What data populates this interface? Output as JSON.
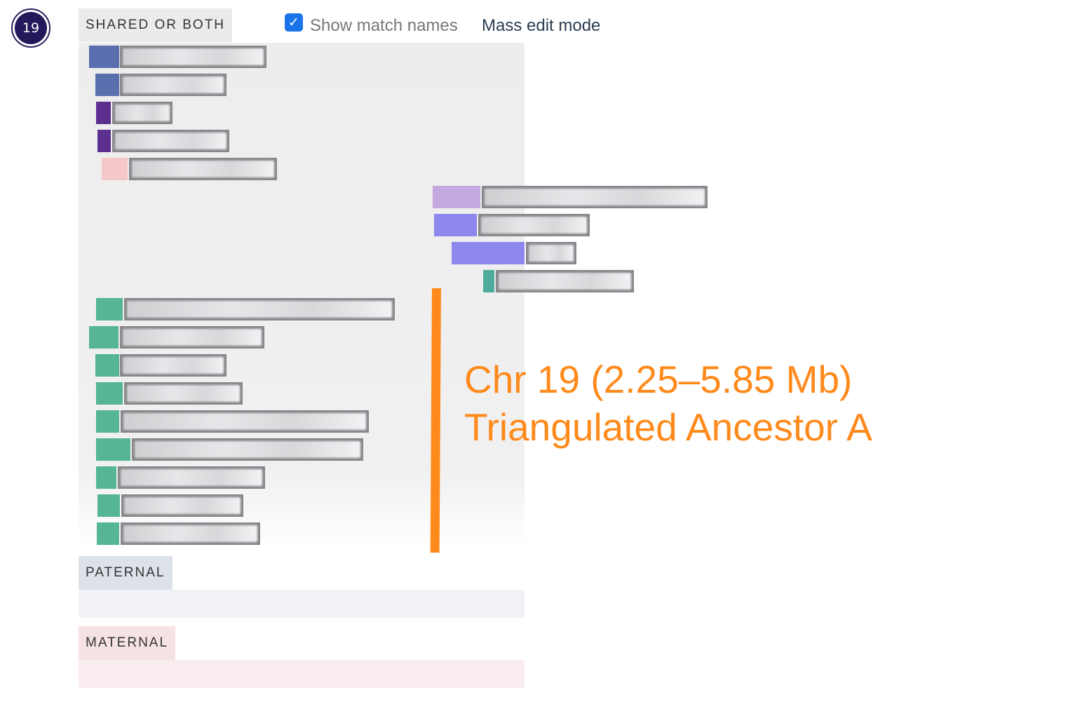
{
  "chromosome": {
    "number": "19"
  },
  "sections": {
    "shared_label": "SHARED OR BOTH",
    "paternal_label": "PATERNAL",
    "maternal_label": "MATERNAL"
  },
  "toolbar": {
    "show_match_names_label": "Show match names",
    "show_match_names_checked": true,
    "mass_edit_label": "Mass edit mode"
  },
  "annotation": {
    "line1": "Chr 19 (2.25–5.85 Mb)",
    "line2": "Triangulated Ancestor A",
    "color": "#ff8a1c"
  },
  "colors": {
    "blue": "#5a6fae",
    "purple": "#5c2f8f",
    "pink": "#f6c7c9",
    "lavender": "#c3a9e0",
    "periwinkle": "#8e87ee",
    "teal": "#4fab9c",
    "green": "#55b594",
    "name_box": "#87878c"
  },
  "matches": [
    {
      "color": "#5a6fae",
      "name_visible": false
    },
    {
      "color": "#5a6fae",
      "name_visible": false
    },
    {
      "color": "#5c2f8f",
      "name_visible": false
    },
    {
      "color": "#5c2f8f",
      "name_visible": false
    },
    {
      "color": "#f6c7c9",
      "name_visible": false
    },
    {
      "color": "#c3a9e0",
      "name_visible": false
    },
    {
      "color": "#8e87ee",
      "name_visible": false
    },
    {
      "color": "#8e87ee",
      "name_visible": false
    },
    {
      "color": "#4fab9c",
      "name_visible": false
    },
    {
      "color": "#55b594",
      "name_visible": false
    },
    {
      "color": "#55b594",
      "name_visible": false
    },
    {
      "color": "#55b594",
      "name_visible": false
    },
    {
      "color": "#55b594",
      "name_visible": false
    },
    {
      "color": "#55b594",
      "name_visible": false
    },
    {
      "color": "#55b594",
      "name_visible": false
    },
    {
      "color": "#55b594",
      "name_visible": false
    },
    {
      "color": "#55b594",
      "name_visible": false
    },
    {
      "color": "#55b594",
      "name_visible": false
    }
  ]
}
